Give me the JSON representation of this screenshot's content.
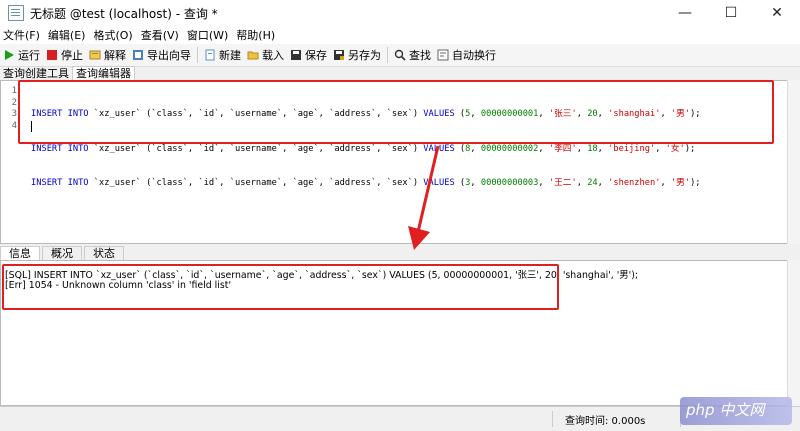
{
  "window": {
    "title": "无标题 @test (localhost) - 查询 *"
  },
  "menu": [
    "文件(F)",
    "编辑(E)",
    "格式(O)",
    "查看(V)",
    "窗口(W)",
    "帮助(H)"
  ],
  "toolbar": {
    "run": "运行",
    "stop": "停止",
    "explain": "解释",
    "export_wizard": "导出向导",
    "new": "新建",
    "load": "载入",
    "save": "保存",
    "save_as": "另存为",
    "find": "查找",
    "word_wrap": "自动换行"
  },
  "editor_tabs": [
    "查询创建工具",
    "查询编辑器"
  ],
  "editor": {
    "lines": [
      "1",
      "2",
      "3",
      "4"
    ],
    "code": [
      {
        "kw1": "INSERT INTO",
        "mid": " `xz_user` (`class`, `id`, `username`, `age`, `address`, `sex`) ",
        "kw2": "VALUES",
        "pre": " (",
        "n1": "5",
        "c1": ", ",
        "n2": "00000000001",
        "c2": ", ",
        "s1": "'张三'",
        "c3": ", ",
        "n3": "20",
        "c4": ", ",
        "s2": "'shanghai'",
        "c5": ", ",
        "s3": "'男'",
        "end": ");"
      },
      {
        "kw1": "INSERT INTO",
        "mid": " `xz_user` (`class`, `id`, `username`, `age`, `address`, `sex`) ",
        "kw2": "VALUES",
        "pre": " (",
        "n1": "8",
        "c1": ", ",
        "n2": "00000000002",
        "c2": ", ",
        "s1": "'李四'",
        "c3": ", ",
        "n3": "18",
        "c4": ", ",
        "s2": "'beijing'",
        "c5": ", ",
        "s3": "'女'",
        "end": ");"
      },
      {
        "kw1": "INSERT INTO",
        "mid": " `xz_user` (`class`, `id`, `username`, `age`, `address`, `sex`) ",
        "kw2": "VALUES",
        "pre": " (",
        "n1": "3",
        "c1": ", ",
        "n2": "00000000003",
        "c2": ", ",
        "s1": "'王二'",
        "c3": ", ",
        "n3": "24",
        "c4": ", ",
        "s2": "'shenzhen'",
        "c5": ", ",
        "s3": "'男'",
        "end": ");"
      }
    ]
  },
  "result_tabs": [
    "信息",
    "概况",
    "状态"
  ],
  "messages": [
    "[SQL] INSERT INTO `xz_user` (`class`, `id`, `username`, `age`, `address`, `sex`) VALUES (5, 00000000001, '张三', 20, 'shanghai', '男');",
    "[Err] 1054 - Unknown column 'class' in 'field list'"
  ],
  "status": {
    "query_time": "查询时间: 0.000s"
  },
  "watermark": "php 中文网",
  "colors": {
    "annotation": "#e02020",
    "keyword": "#0000cc",
    "string": "#cc0000",
    "number": "#008000"
  }
}
